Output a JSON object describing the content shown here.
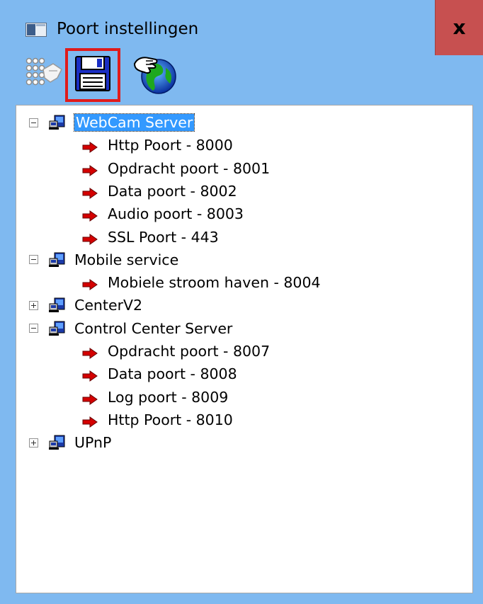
{
  "window": {
    "title": "Poort instellingen",
    "close_label": "x"
  },
  "icons": {
    "app": "window-icon",
    "ports": "port-grid-icon",
    "save": "floppy-disk-icon",
    "web": "globe-hand-icon",
    "server": "network-computer-icon",
    "arrow": "red-arrow-icon"
  },
  "colors": {
    "selection": "#3399ff",
    "close": "#c75050",
    "highlight_border": "#e01b1b",
    "arrow": "#d40000"
  },
  "tree": {
    "nodes": [
      {
        "label": "WebCam Server",
        "expanded": true,
        "selected": true,
        "children": [
          "Http Poort - 8000",
          "Opdracht poort - 8001",
          "Data poort - 8002",
          "Audio poort - 8003",
          "SSL Poort - 443"
        ]
      },
      {
        "label": "Mobile service",
        "expanded": true,
        "selected": false,
        "children": [
          "Mobiele stroom haven - 8004"
        ]
      },
      {
        "label": "CenterV2",
        "expanded": false,
        "selected": false,
        "children": []
      },
      {
        "label": "Control Center Server",
        "expanded": true,
        "selected": false,
        "children": [
          "Opdracht poort - 8007",
          "Data poort - 8008",
          "Log poort - 8009",
          "Http Poort - 8010"
        ]
      },
      {
        "label": "UPnP",
        "expanded": false,
        "selected": false,
        "children": []
      }
    ]
  }
}
